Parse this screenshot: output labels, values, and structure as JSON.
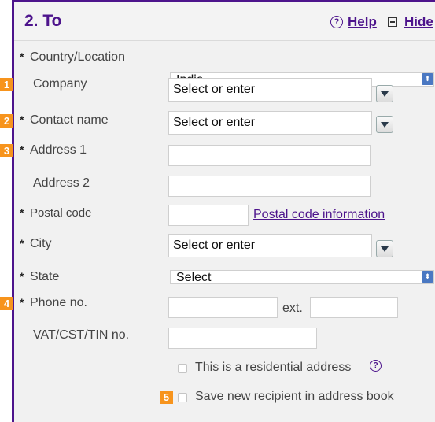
{
  "section": {
    "title": "2. To",
    "help_label": "Help",
    "hide_label": "Hide"
  },
  "fields": {
    "country": {
      "label": "Country/Location",
      "value": "India"
    },
    "company": {
      "label": "Company",
      "badge": "1",
      "value": "Select or enter"
    },
    "contact": {
      "label": "Contact name",
      "badge": "2",
      "value": "Select or enter"
    },
    "address1": {
      "label": "Address 1",
      "badge": "3",
      "value": ""
    },
    "address2": {
      "label": "Address 2",
      "value": ""
    },
    "postal": {
      "label": "Postal code",
      "value": "",
      "link": "Postal code information"
    },
    "city": {
      "label": "City",
      "value": "Select or enter"
    },
    "state": {
      "label": "State",
      "value": "Select"
    },
    "phone": {
      "label": "Phone no.",
      "badge": "4",
      "value": "",
      "ext_label": "ext.",
      "ext_value": ""
    },
    "vat": {
      "label": "VAT/CST/TIN no.",
      "value": ""
    }
  },
  "checkboxes": {
    "residential": {
      "label": "This is a residential address",
      "checked": false
    },
    "save": {
      "label": "Save new recipient in address book",
      "badge": "5",
      "checked": false
    }
  },
  "required_marker": "*",
  "colors": {
    "brand": "#4d148c",
    "badge": "#f7941d",
    "select_arrow": "#4a78c2"
  }
}
